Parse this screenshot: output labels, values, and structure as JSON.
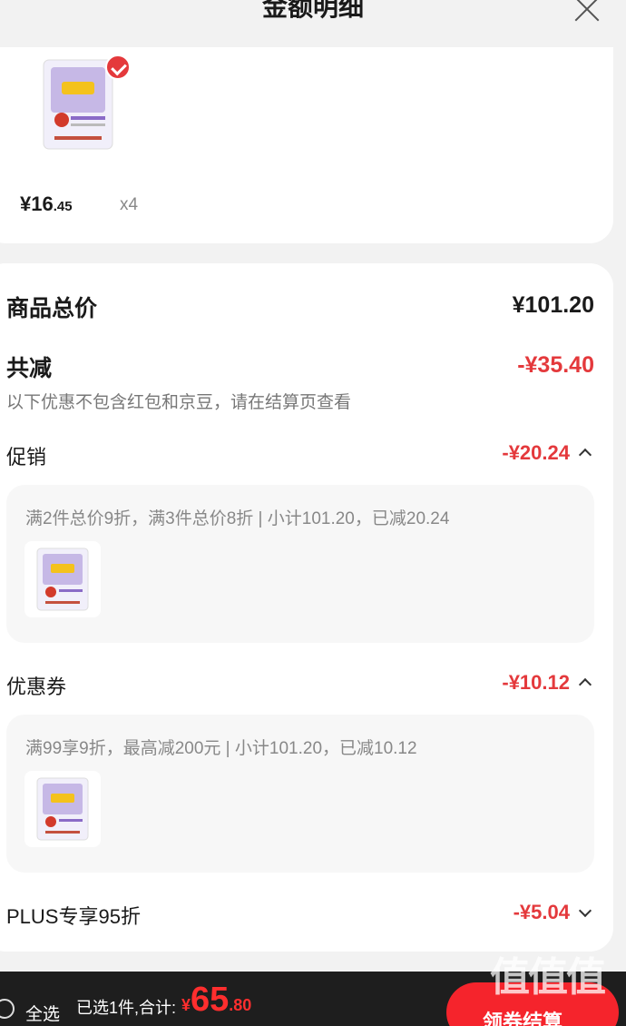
{
  "header": {
    "title": "金额明细"
  },
  "product": {
    "price_main": "¥16",
    "price_decimal": ".45",
    "quantity": "x4"
  },
  "summary": {
    "total_label": "商品总价",
    "total_value": "¥101.20",
    "reduce_label": "共减",
    "reduce_value": "-¥35.40",
    "note": "以下优惠不包含红包和京豆，请在结算页查看"
  },
  "promotion": {
    "label": "促销",
    "amount": "-¥20.24",
    "detail": "满2件总价9折，满3件总价8折 | 小计101.20，已减20.24"
  },
  "coupon": {
    "label": "优惠券",
    "amount": "-¥10.12",
    "detail": "满99享9折，最高减200元 | 小计101.20，已减10.12"
  },
  "plus": {
    "label": "PLUS专享95折",
    "amount": "-¥5.04"
  },
  "bottom": {
    "select_all": "全选",
    "selected_text": "已选1件,合计:",
    "currency": "¥",
    "total_int": "65",
    "total_dec": ".80",
    "checkout": "领券结算"
  },
  "watermark": "值值值",
  "colors": {
    "accent": "#e4393c",
    "bottom_bar": "#1e1e1e",
    "price_red": "#ff2e2e"
  }
}
